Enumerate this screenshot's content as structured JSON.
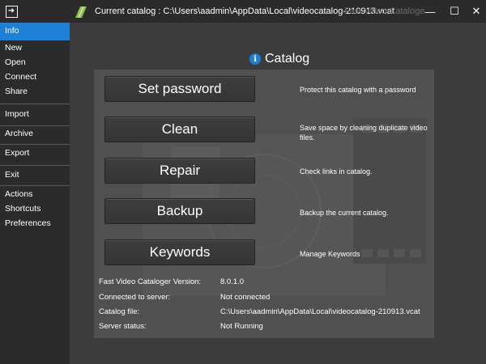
{
  "titlebar": {
    "back_icon": "arrow-right-to-box",
    "app_icon": "film-catalog-logo",
    "title": "Current catalog : C:\\Users\\aadmin\\AppData\\Local\\videocatalog-210913.vcat",
    "ghost_title": "Fast Video Cataloger 8",
    "minimize": "—",
    "maximize": "☐",
    "close": "✕"
  },
  "sidebar": {
    "items": [
      {
        "label": "Info",
        "active": true
      },
      {
        "label": "New"
      },
      {
        "label": "Open"
      },
      {
        "label": "Connect"
      },
      {
        "label": "Share"
      },
      {
        "label": "Import"
      },
      {
        "label": "Archive"
      },
      {
        "label": "Export"
      },
      {
        "label": "Exit"
      },
      {
        "label": "Actions"
      },
      {
        "label": "Shortcuts"
      },
      {
        "label": "Preferences"
      }
    ]
  },
  "main": {
    "header": {
      "icon": "info-icon",
      "title": "Catalog"
    },
    "actions": [
      {
        "label": "Set password",
        "description": "Protect this catalog with a password"
      },
      {
        "label": "Clean",
        "description": "Save space by cleaning duplicate video files."
      },
      {
        "label": "Repair",
        "description": "Check links in catalog."
      },
      {
        "label": "Backup",
        "description": "Backup the current catalog."
      },
      {
        "label": "Keywords",
        "description": "Manage Keywords"
      }
    ],
    "info": [
      {
        "label": "Fast Video Cataloger Version:",
        "value": "8.0.1.0"
      },
      {
        "label": "Connected to server:",
        "value": "Not connected"
      },
      {
        "label": "Catalog file:",
        "value": "C:\\Users\\aadmin\\AppData\\Local\\videocatalog-210913.vcat"
      },
      {
        "label": "Server status:",
        "value": "Not Running"
      }
    ]
  },
  "colors": {
    "accent": "#1e7fd6",
    "sidebar_bg": "#2b2b2b",
    "main_bg": "#3c3c3c",
    "panel_bg": "#505050"
  }
}
